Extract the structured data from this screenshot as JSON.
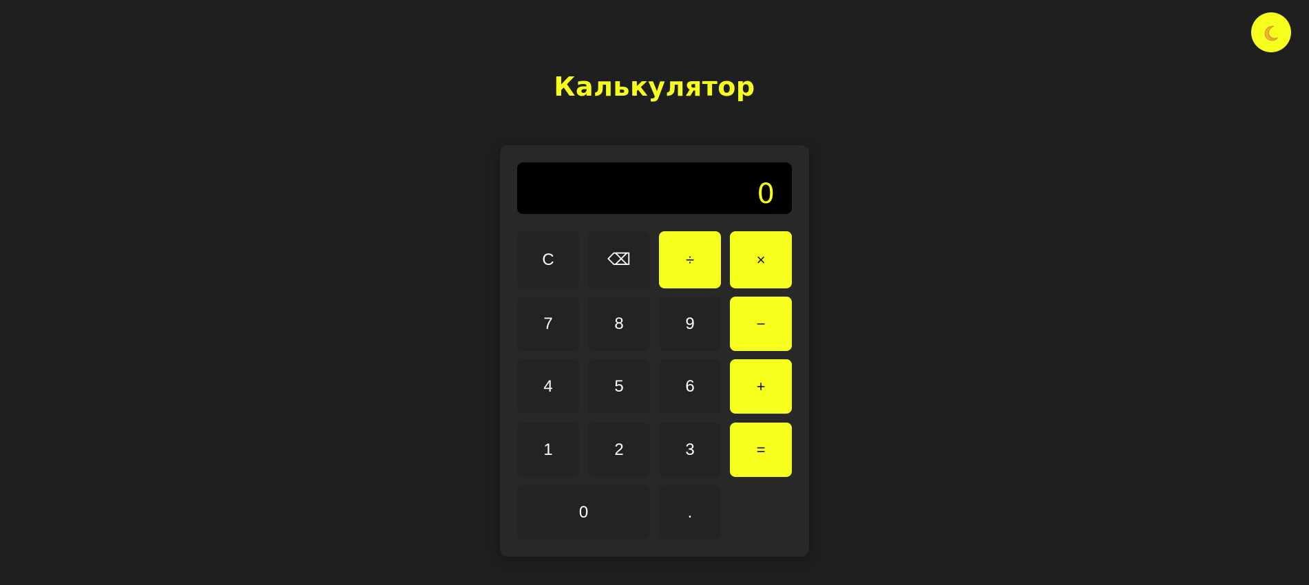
{
  "app": {
    "title": "Калькулятор",
    "accent_color": "#f7ff1f",
    "background_color": "#1f1f1f"
  },
  "theme_toggle": {
    "icon": "moon-icon"
  },
  "display": {
    "value": "0"
  },
  "keys": {
    "clear": "C",
    "backspace": "⌫",
    "divide": "÷",
    "multiply": "×",
    "seven": "7",
    "eight": "8",
    "nine": "9",
    "minus": "−",
    "four": "4",
    "five": "5",
    "six": "6",
    "plus": "+",
    "one": "1",
    "two": "2",
    "three": "3",
    "equals": "=",
    "zero": "0",
    "decimal": "."
  }
}
